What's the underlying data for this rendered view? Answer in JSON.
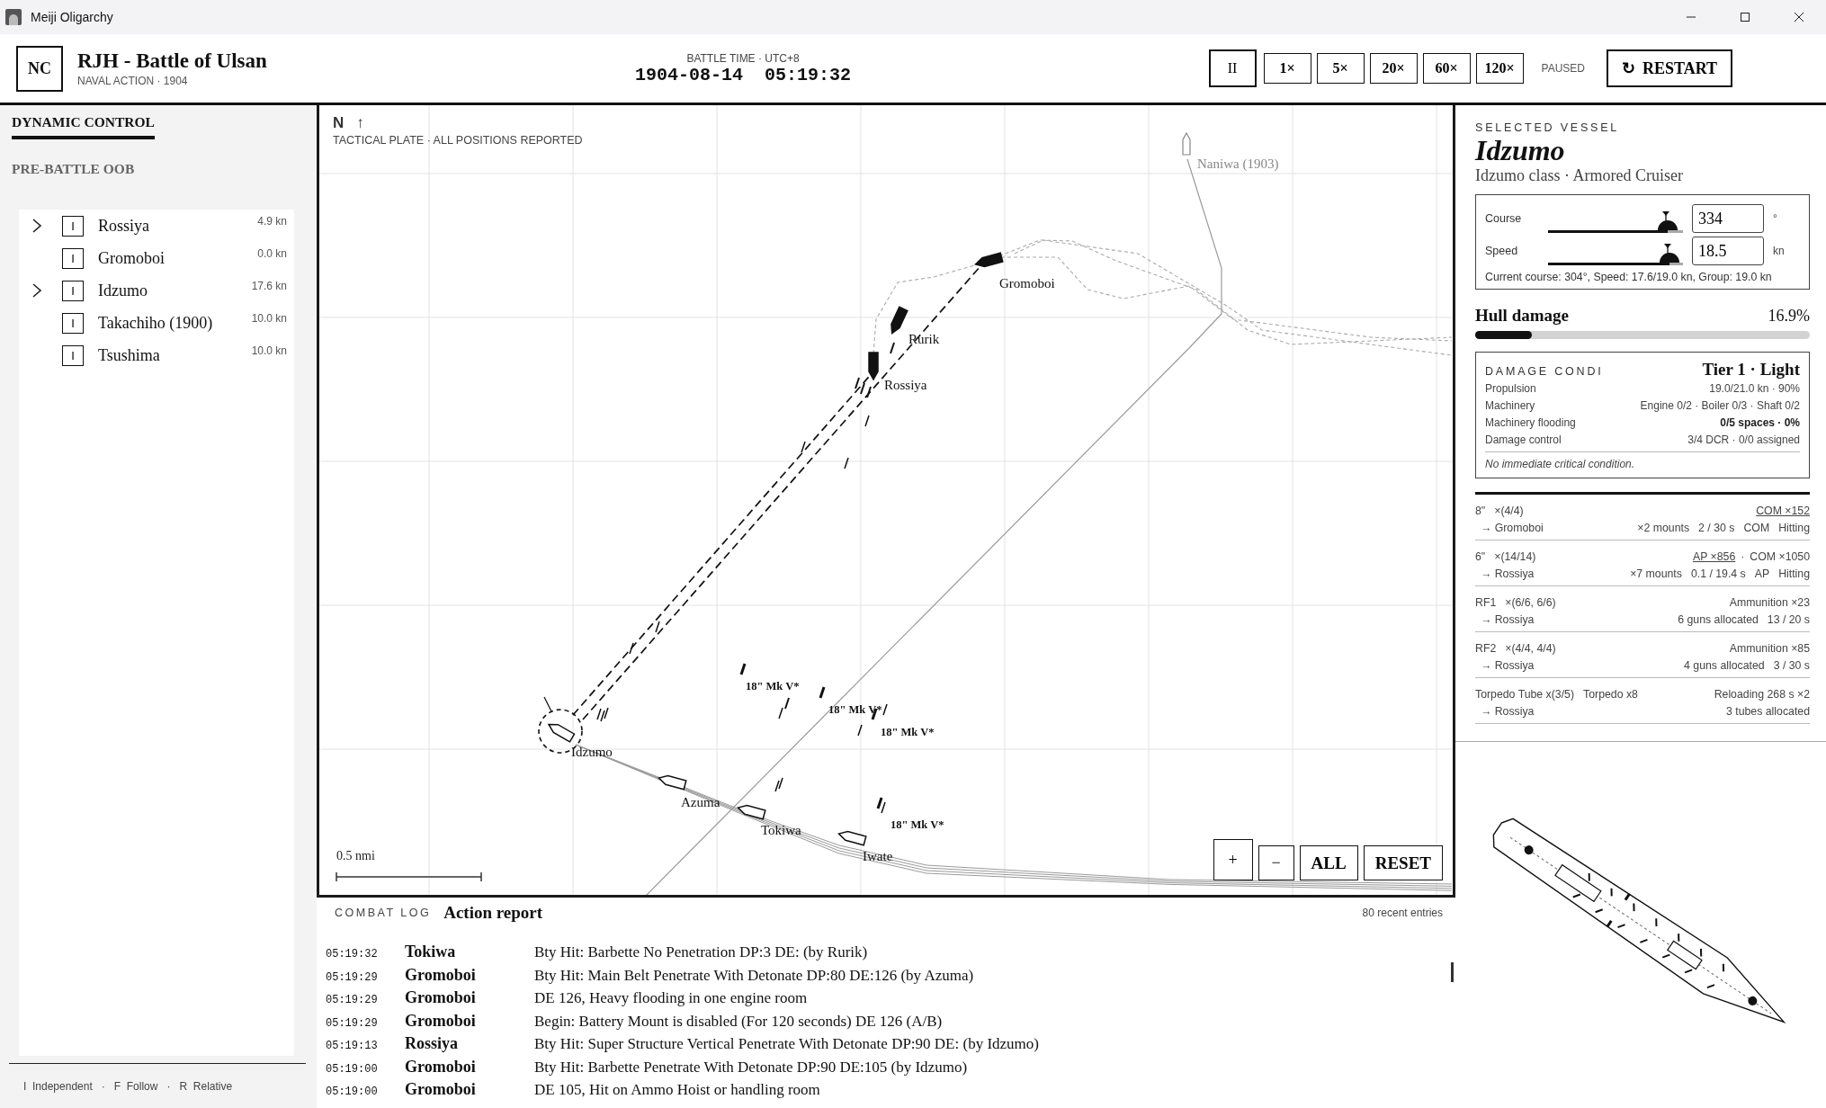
{
  "window": {
    "title": "Meiji Oligarchy"
  },
  "header": {
    "badge": "NC",
    "title": "RJH - Battle of Ulsan",
    "subtitle": "NAVAL ACTION · 1904",
    "clock_label": "BATTLE TIME · UTC+8",
    "date": "1904-08-14",
    "time": "05:19:32",
    "playback": [
      {
        "label": "II",
        "selected": true
      },
      {
        "label": "1×",
        "selected": false
      },
      {
        "label": "5×",
        "selected": false
      },
      {
        "label": "20×",
        "selected": false
      },
      {
        "label": "60×",
        "selected": false
      },
      {
        "label": "120×",
        "selected": false
      }
    ],
    "status": "PAUSED",
    "restart": {
      "icon": "↻",
      "label": "RESTART"
    }
  },
  "sidebar": {
    "tabs": [
      {
        "label": "DYNAMIC CONTROL",
        "selected": true
      },
      {
        "label": "PRE-BATTLE OOB",
        "selected": false
      }
    ],
    "ships": [
      {
        "name": "Rossiya",
        "mode": "I",
        "speed": "4.9 kn",
        "expandable": true
      },
      {
        "name": "Gromoboi",
        "mode": "I",
        "speed": "0.0 kn",
        "expandable": false
      },
      {
        "name": "Idzumo",
        "mode": "I",
        "speed": "17.6 kn",
        "expandable": true
      },
      {
        "name": "Takachiho (1900)",
        "mode": "I",
        "speed": "10.0 kn",
        "expandable": false
      },
      {
        "name": "Tsushima",
        "mode": "I",
        "speed": "10.0 kn",
        "expandable": false
      }
    ],
    "legend_separator": "·",
    "legend": [
      {
        "key": "I",
        "label": "Independent"
      },
      {
        "key": "F",
        "label": "Follow"
      },
      {
        "key": "R",
        "label": "Relative"
      }
    ]
  },
  "map": {
    "north": "N",
    "north_arrow": "↑",
    "caption": "TACTICAL PLATE · ALL POSITIONS REPORTED",
    "ships": [
      {
        "name": "Naniwa (1903)",
        "kind": "distant",
        "selected": false
      },
      {
        "name": "Gromoboi",
        "kind": "enemy",
        "selected": false
      },
      {
        "name": "Rurik",
        "kind": "enemy",
        "selected": false
      },
      {
        "name": "Rossiya",
        "kind": "enemy",
        "selected": false
      },
      {
        "name": "Idzumo",
        "kind": "friendly",
        "selected": true
      },
      {
        "name": "Azuma",
        "kind": "friendly",
        "selected": false
      },
      {
        "name": "Tokiwa",
        "kind": "friendly",
        "selected": false
      },
      {
        "name": "Iwate",
        "kind": "friendly",
        "selected": false
      }
    ],
    "torpedoes": [
      "18\" Mk V*",
      "18\" Mk V*",
      "18\" Mk V*",
      "18\" Mk V*"
    ],
    "scale": "0.5 nmi",
    "zoom_controls": [
      "+",
      "−",
      "ALL",
      "RESET"
    ]
  },
  "log": {
    "title": "COMBAT LOG",
    "subtitle": "Action report",
    "count": "80 recent entries",
    "entries": [
      {
        "time": "05:19:32",
        "ship": "Tokiwa",
        "message": "Bty Hit: Barbette No Penetration DP:3 DE: (by Rurik)"
      },
      {
        "time": "05:19:29",
        "ship": "Gromoboi",
        "message": "Bty Hit: Main Belt Penetrate With Detonate DP:80 DE:126 (by Azuma)"
      },
      {
        "time": "05:19:29",
        "ship": "Gromoboi",
        "message": "DE 126, Heavy flooding in one engine room"
      },
      {
        "time": "05:19:29",
        "ship": "Gromoboi",
        "message": "Begin: Battery Mount is disabled (For 120 seconds) DE 126 (A/B)"
      },
      {
        "time": "05:19:13",
        "ship": "Rossiya",
        "message": "Bty Hit: Super Structure Vertical Penetrate With Detonate DP:90 DE: (by Idzumo)"
      },
      {
        "time": "05:19:00",
        "ship": "Gromoboi",
        "message": "Bty Hit: Barbette Penetrate With Detonate DP:90 DE:105 (by Idzumo)"
      },
      {
        "time": "05:19:00",
        "ship": "Gromoboi",
        "message": "DE 105, Hit on Ammo Hoist or handling room"
      }
    ]
  },
  "vessel": {
    "section_label": "SELECTED VESSEL",
    "name": "Idzumo",
    "class": "Idzumo class · Armored Cruiser",
    "orders": [
      {
        "label": "Course",
        "level": 0.885,
        "value": "334",
        "unit": "°"
      },
      {
        "label": "Speed",
        "level": 0.9,
        "value": "18.5",
        "unit": "kn"
      }
    ],
    "current": "Current course: 304°, Speed: 17.6/19.0 kn, Group: 19.0 kn",
    "hull": {
      "label": "Hull damage",
      "value": "16.9%",
      "level": 0.169
    },
    "damage": {
      "title": "DAMAGE CONDI",
      "tier": "Tier 1 · Light",
      "rows": [
        {
          "label": "Propulsion",
          "value": "19.0/21.0 kn · 90%",
          "emphasis": false
        },
        {
          "label": "Machinery",
          "value": "Engine 0/2 · Boiler 0/3 · Shaft 0/2",
          "emphasis": false
        },
        {
          "label": "Machinery flooding",
          "value": "0/5 spaces · 0%",
          "emphasis": true
        },
        {
          "label": "Damage control",
          "value": "3/4 DCR · 0/0 assigned",
          "emphasis": false
        }
      ],
      "note": "No immediate critical condition."
    },
    "weapons": [
      {
        "name": "8\"",
        "mounts": "×(4/4)",
        "ammo": [
          {
            "label": "COM ×152",
            "selected": true
          }
        ],
        "target": "→ Gromoboi",
        "details": [
          "×2 mounts",
          "2 / 30 s",
          "COM",
          "Hitting"
        ]
      },
      {
        "name": "6\"",
        "mounts": "×(14/14)",
        "separator": "·",
        "ammo": [
          {
            "label": "AP ×856",
            "selected": true
          },
          {
            "label": "COM ×1050",
            "selected": false
          }
        ],
        "target": "→ Rossiya",
        "details": [
          "×7 mounts",
          "0.1 / 19.4 s",
          "AP",
          "Hitting"
        ]
      },
      {
        "name": "RF1",
        "mounts": "×(6/6, 6/6)",
        "status": "Ammunition ×23",
        "target": "→ Rossiya",
        "details": [
          "6 guns allocated",
          "13 / 20 s"
        ]
      },
      {
        "name": "RF2",
        "mounts": "×(4/4, 4/4)",
        "status": "Ammunition ×85",
        "target": "→ Rossiya",
        "details": [
          "4 guns allocated",
          "3 / 30 s"
        ]
      },
      {
        "name": "Torpedo Tube x(3/5)",
        "mounts": "Torpedo x8",
        "status": "Reloading 268 s ×2",
        "target": "→ Rossiya",
        "details": [
          "3 tubes allocated"
        ]
      }
    ]
  }
}
